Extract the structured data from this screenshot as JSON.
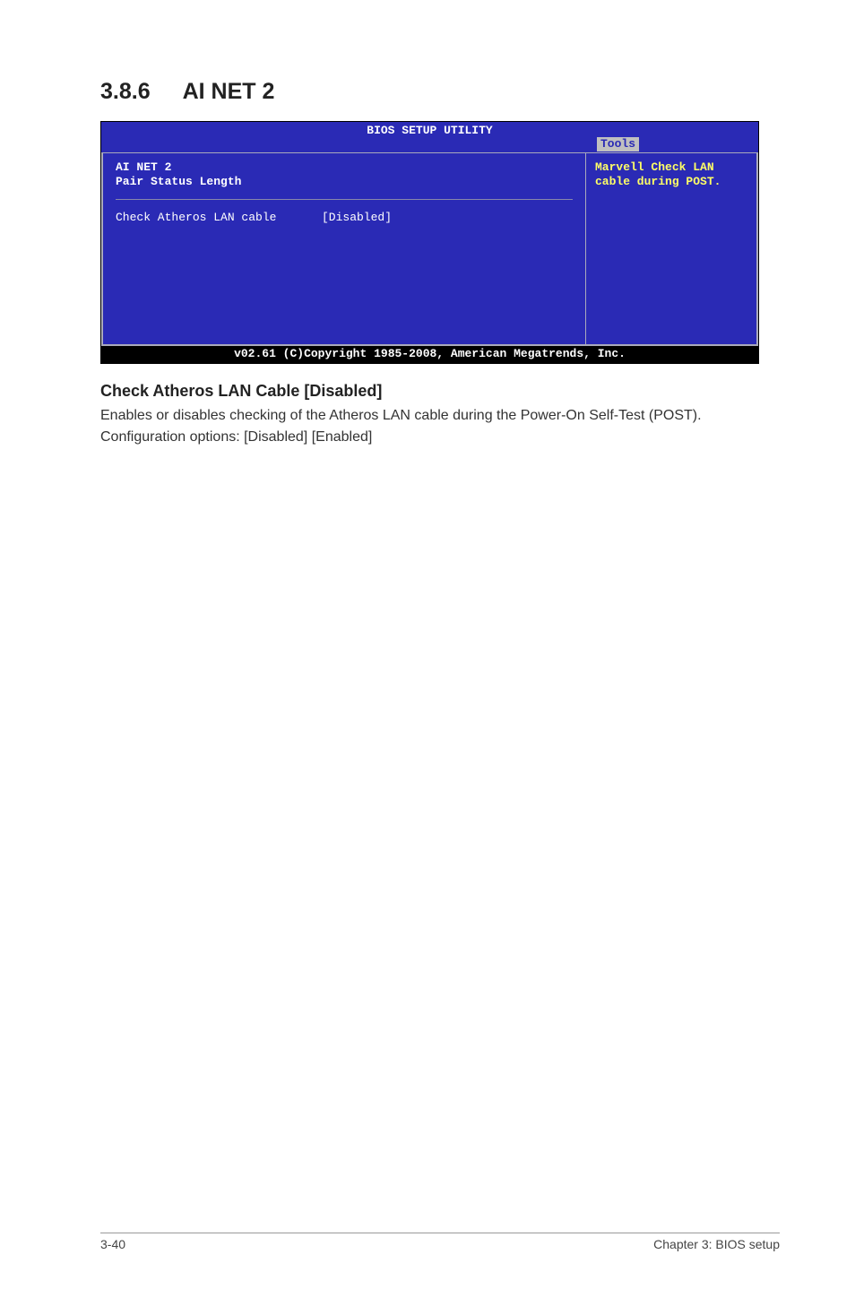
{
  "heading": {
    "number": "3.8.6",
    "title": "AI NET 2"
  },
  "bios": {
    "title": "BIOS SETUP UTILITY",
    "tab": "Tools",
    "left": {
      "line1": "AI NET 2",
      "line2": "Pair  Status  Length",
      "option_label": "Check Atheros LAN cable",
      "option_value": "[Disabled]"
    },
    "right": {
      "help1": "Marvell Check LAN",
      "help2": "cable during POST."
    },
    "footer": "v02.61 (C)Copyright 1985-2008, American Megatrends, Inc."
  },
  "subheading": "Check Atheros LAN Cable [Disabled]",
  "para1": "Enables or disables checking of the Atheros LAN cable during the Power-On Self-Test (POST).",
  "para2": "Configuration options: [Disabled] [Enabled]",
  "footer": {
    "left": "3-40",
    "right": "Chapter 3: BIOS setup"
  }
}
